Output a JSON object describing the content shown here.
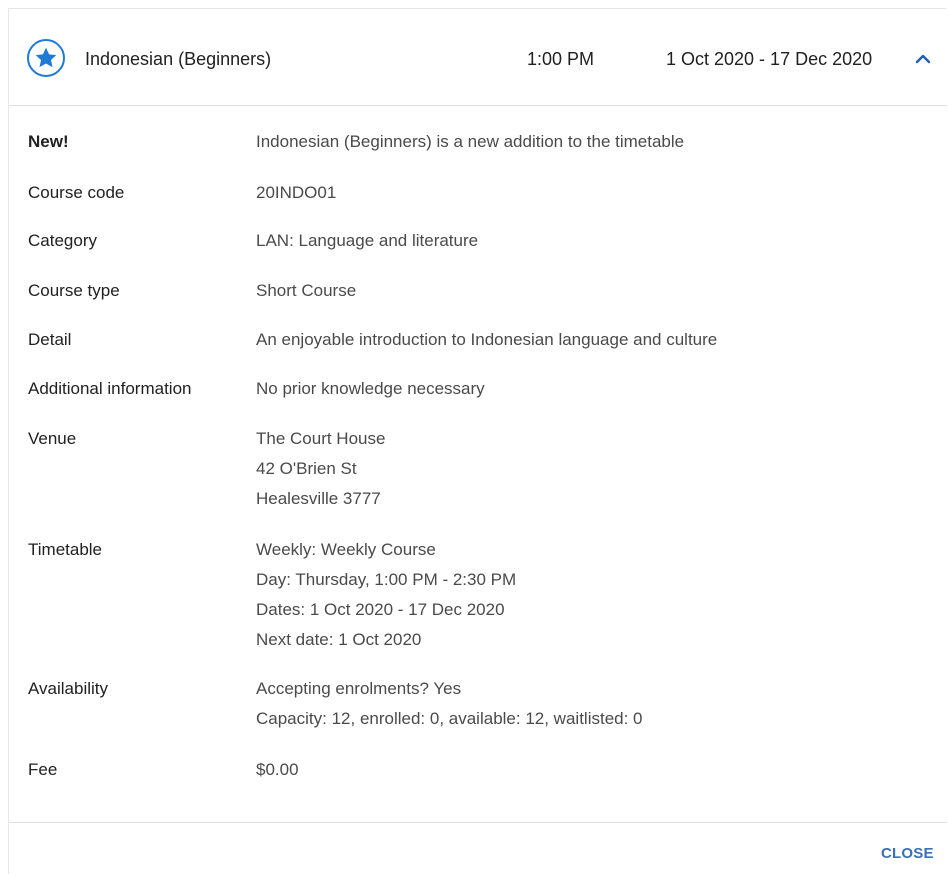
{
  "header": {
    "icon": "star-icon",
    "title": "Indonesian (Beginners)",
    "time": "1:00 PM",
    "dates": "1 Oct 2020 - 17 Dec 2020",
    "toggle_icon": "chevron-up-icon"
  },
  "details": {
    "new": {
      "label": "New!",
      "value": "Indonesian (Beginners) is a new addition to the timetable"
    },
    "course_code": {
      "label": "Course code",
      "value": "20INDO01"
    },
    "category": {
      "label": "Category",
      "value": "LAN: Language and literature"
    },
    "course_type": {
      "label": "Course type",
      "value": "Short Course"
    },
    "detail": {
      "label": "Detail",
      "value": "An enjoyable introduction to Indonesian language and culture"
    },
    "additional_information": {
      "label": "Additional information",
      "value": "No prior knowledge necessary"
    },
    "venue": {
      "label": "Venue",
      "lines": [
        "The Court House",
        "42 O'Brien St",
        "Healesville 3777"
      ]
    },
    "timetable": {
      "label": "Timetable",
      "lines": [
        "Weekly: Weekly Course",
        "Day: Thursday, 1:00 PM - 2:30 PM",
        "Dates: 1 Oct 2020 - 17 Dec 2020",
        "Next date: 1 Oct 2020"
      ]
    },
    "availability": {
      "label": "Availability",
      "lines": [
        "Accepting enrolments? Yes",
        "Capacity: 12, enrolled: 0, available: 12, waitlisted: 0"
      ]
    },
    "fee": {
      "label": "Fee",
      "value": "$0.00"
    }
  },
  "footer": {
    "close_label": "CLOSE"
  },
  "colors": {
    "accent": "#1f7ad6",
    "close_button": "#3b6fb6"
  }
}
